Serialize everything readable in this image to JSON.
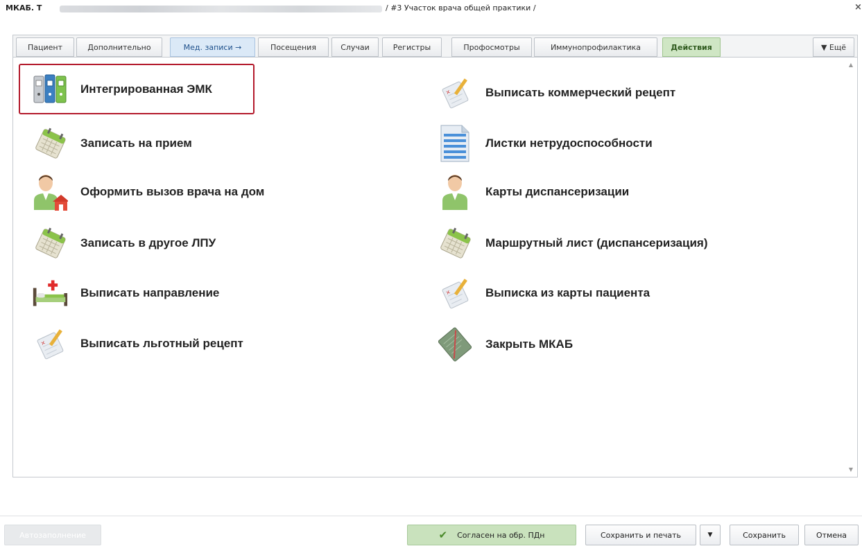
{
  "window": {
    "title_prefix": "МКАБ. Т",
    "title_suffix": "/ #3 Участок врача общей практики /",
    "close_label": "×"
  },
  "tabs": [
    {
      "label": "Пациент"
    },
    {
      "label": "Дополнительно"
    },
    {
      "label": "Мед. записи →"
    },
    {
      "label": "Посещения"
    },
    {
      "label": "Случаи"
    },
    {
      "label": "Регистры"
    },
    {
      "label": "Профосмотры"
    },
    {
      "label": "Иммунопрофилактика"
    },
    {
      "label": "Действия"
    },
    {
      "label": "▼ Ещё"
    }
  ],
  "actions_left": [
    {
      "label": "Интегрированная ЭМК",
      "icon": "integrated-emk-icon"
    },
    {
      "label": "Записать на прием",
      "icon": "calendar-icon"
    },
    {
      "label": "Оформить вызов врача на дом",
      "icon": "doctor-home-icon"
    },
    {
      "label": "Записать в другое ЛПУ",
      "icon": "calendar-icon"
    },
    {
      "label": "Выписать направление",
      "icon": "hospital-bed-icon"
    },
    {
      "label": "Выписать льготный рецепт",
      "icon": "prescription-icon"
    }
  ],
  "actions_right": [
    {
      "label": "Выписать коммерческий рецепт",
      "icon": "prescription-icon"
    },
    {
      "label": "Листки нетрудоспособности",
      "icon": "sick-leave-icon"
    },
    {
      "label": "Карты диспансеризации",
      "icon": "doctor-icon"
    },
    {
      "label": "Маршрутный лист (диспансеризация)",
      "icon": "calendar-icon"
    },
    {
      "label": "Выписка из карты пациента",
      "icon": "prescription-icon"
    },
    {
      "label": "Закрыть МКАБ",
      "icon": "close-card-icon"
    }
  ],
  "footer": {
    "autofill": "Автозаполнение",
    "consent": "Согласен на обр. ПДн",
    "save_print": "Сохранить и печать",
    "save": "Сохранить",
    "cancel": "Отмена"
  },
  "colors": {
    "highlight": "#b3192b",
    "active_tab_blue": "#dbe9f7",
    "active_tab_green": "#cfe6c4"
  }
}
